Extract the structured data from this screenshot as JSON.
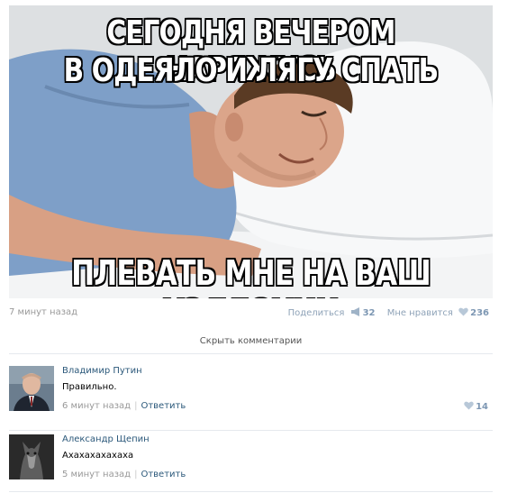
{
  "post": {
    "meme_top_line1": "СЕГОДНЯ ВЕЧЕРОМ НАРЯЖУСЬ",
    "meme_top_line2": "В ОДЕЯЛО И ЛЯГУ СПАТЬ",
    "meme_bottom": "ПЛЕВАТЬ МНЕ НА ВАШ ХЭЛЛОУИН",
    "time": "7 минут назад",
    "share_label": "Поделиться",
    "share_count": "32",
    "like_label": "Мне нравится",
    "like_count": "236"
  },
  "comments_toggle": "Скрыть комментарии",
  "comments": [
    {
      "author": "Владимир Путин",
      "text": "Правильно.",
      "time": "6 минут назад",
      "reply": "Ответить",
      "likes": "14"
    },
    {
      "author": "Александр Щепин",
      "text": "Ахахахахахаха",
      "time": "5 минут назад",
      "reply": "Ответить"
    }
  ],
  "colors": {
    "link": "#2b587a",
    "muted": "#999999",
    "like_accent": "#7d97b3",
    "divider": "#e5e9ee"
  },
  "icons": [
    "megaphone-icon",
    "heart-icon"
  ]
}
